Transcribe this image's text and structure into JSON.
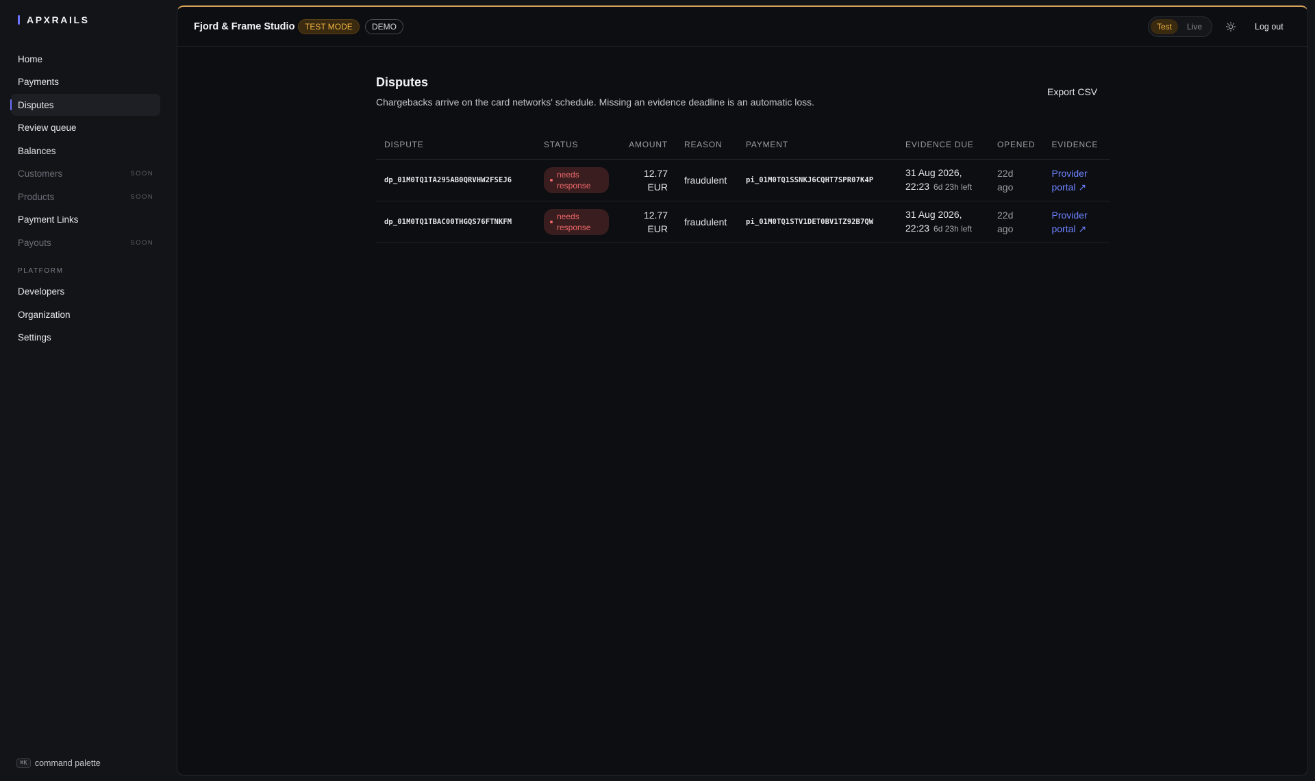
{
  "brand": {
    "name": "APXRAILS",
    "accent": "#6d72ff"
  },
  "sidebar": {
    "items": [
      {
        "label": "Home"
      },
      {
        "label": "Payments"
      },
      {
        "label": "Disputes",
        "active": true
      },
      {
        "label": "Review queue"
      },
      {
        "label": "Balances"
      },
      {
        "label": "Customers",
        "badge": "SOON",
        "disabled": true
      },
      {
        "label": "Products",
        "badge": "SOON",
        "disabled": true
      },
      {
        "label": "Payment Links"
      },
      {
        "label": "Payouts",
        "badge": "SOON",
        "disabled": true
      }
    ],
    "section_label": "PLATFORM",
    "platform_items": [
      {
        "label": "Developers"
      },
      {
        "label": "Organization"
      },
      {
        "label": "Settings"
      }
    ],
    "command_palette": {
      "shortcut": "⌘K",
      "label": "command palette"
    }
  },
  "topbar": {
    "org_name": "Fjord & Frame Studio",
    "test_mode_badge": "TEST MODE",
    "demo_badge": "DEMO",
    "mode_test": "Test",
    "mode_live": "Live",
    "theme_icon": "sun-icon",
    "logout": "Log out",
    "accent": "#d8a35c"
  },
  "page": {
    "title": "Disputes",
    "subtitle": "Chargebacks arrive on the card networks' schedule. Missing an evidence deadline is an automatic loss.",
    "export": "Export CSV"
  },
  "table": {
    "headers": {
      "dispute": "DISPUTE",
      "status": "STATUS",
      "amount": "AMOUNT",
      "reason": "REASON",
      "payment": "PAYMENT",
      "evidence_due": "EVIDENCE DUE",
      "opened": "OPENED",
      "evidence": "EVIDENCE"
    },
    "rows": [
      {
        "dispute": "dp_01M0TQ1TA295AB0QRVHW2FSEJ6",
        "status": "needs response",
        "amount": "12.77",
        "currency": "EUR",
        "reason": "fraudulent",
        "payment": "pi_01M0TQ1SSNKJ6CQHT7SPR07K4P",
        "due_date": "31 Aug 2026,",
        "due_time": "22:23",
        "due_left": "6d 23h left",
        "opened_1": "22d",
        "opened_2": "ago",
        "evidence_1": "Provider",
        "evidence_2": "portal ↗"
      },
      {
        "dispute": "dp_01M0TQ1TBAC00THGQS76FTNKFM",
        "status": "needs response",
        "amount": "12.77",
        "currency": "EUR",
        "reason": "fraudulent",
        "payment": "pi_01M0TQ1STV1DET0BV1TZ92B7QW",
        "due_date": "31 Aug 2026,",
        "due_time": "22:23",
        "due_left": "6d 23h left",
        "opened_1": "22d",
        "opened_2": "ago",
        "evidence_1": "Provider",
        "evidence_2": "portal ↗"
      }
    ],
    "status_color": "#f06a6a",
    "link_color": "#6c82ff"
  }
}
